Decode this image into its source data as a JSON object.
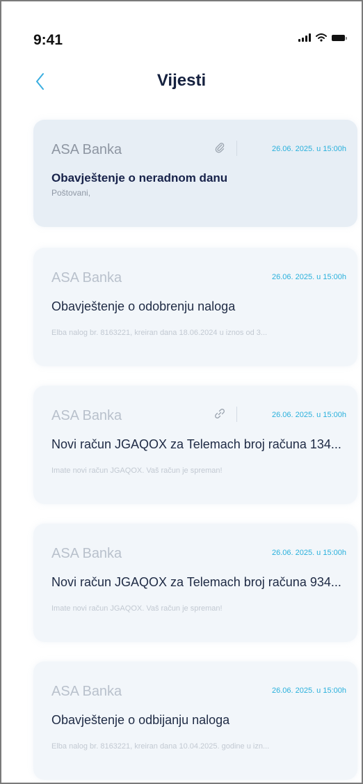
{
  "status_bar": {
    "time": "9:41"
  },
  "header": {
    "title": "Vijesti"
  },
  "news": [
    {
      "sender": "ASA Banka",
      "date": "26.06. 2025. u 15:00h",
      "title": "Obavještenje o neradnom danu",
      "preview": "Poštovani,",
      "unread": true,
      "has_attachment": true
    },
    {
      "sender": "ASA Banka",
      "date": "26.06. 2025. u 15:00h",
      "title": "Obavještenje o odobrenju naloga",
      "preview": "Elba nalog br. 8163221, kreiran dana 18.06.2024 u iznos od 3...",
      "unread": false,
      "has_attachment": false
    },
    {
      "sender": "ASA Banka",
      "date": "26.06. 2025. u 15:00h",
      "title": "Novi račun JGAQOX za Telemach broj računa 134...",
      "preview": "Imate novi račun JGAQOX. Vaš račun je spreman!",
      "unread": false,
      "has_attachment": true
    },
    {
      "sender": "ASA Banka",
      "date": "26.06. 2025. u 15:00h",
      "title": "Novi račun JGAQOX za Telemach broj računa 934...",
      "preview": "Imate novi račun JGAQOX. Vaš račun je spreman!",
      "unread": false,
      "has_attachment": false
    },
    {
      "sender": "ASA Banka",
      "date": "26.06. 2025. u 15:00h",
      "title": "Obavještenje o odbijanju naloga",
      "preview": "Elba nalog br. 8163221, kreiran dana 10.04.2025. godine u izn...",
      "unread": false,
      "has_attachment": false
    }
  ],
  "colors": {
    "accent": "#29b0dc",
    "title": "#15213f",
    "card_bg": "#f2f6fa",
    "card_bg_unread": "#e7eef5"
  },
  "icons": {
    "back": "chevron-left-icon",
    "attachment": "paperclip-icon",
    "signal": "signal-icon",
    "wifi": "wifi-icon",
    "battery": "battery-icon"
  }
}
